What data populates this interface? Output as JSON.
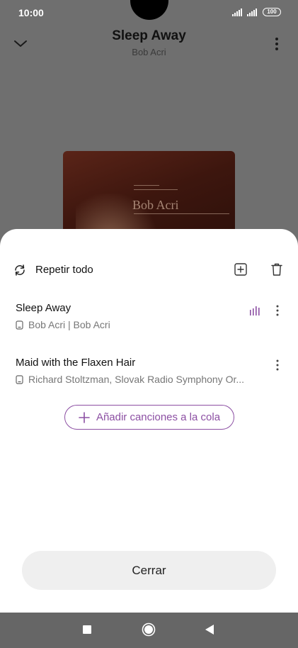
{
  "status": {
    "time": "10:00",
    "battery": "100"
  },
  "player": {
    "title": "Sleep Away",
    "artist": "Bob Acri"
  },
  "album_art": {
    "brand_text": "Bob Acri"
  },
  "sheet": {
    "repeat_label": "Repetir todo",
    "tracks": [
      {
        "title": "Sleep Away",
        "meta": "Bob Acri | Bob Acri",
        "playing": true
      },
      {
        "title": "Maid with the Flaxen Hair",
        "meta": "Richard Stoltzman, Slovak Radio Symphony Or...",
        "playing": false
      }
    ],
    "add_to_queue_label": "Añadir canciones a la cola",
    "close_label": "Cerrar"
  },
  "colors": {
    "accent": "#8c4fa3",
    "dim_overlay": "#6f6f6f",
    "nav_bar": "#666666"
  }
}
